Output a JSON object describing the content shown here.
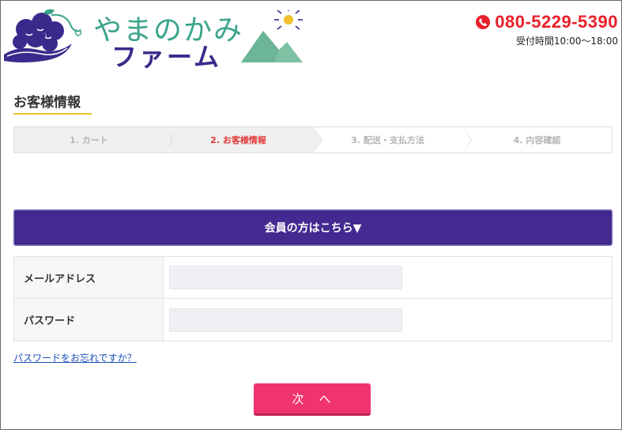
{
  "header": {
    "logo_line1": "やまのかみ",
    "logo_line2": "ファーム",
    "phone_number": "080-5229-5390",
    "business_hours": "受付時間10:00〜18:00"
  },
  "page_title": "お客様情報",
  "steps": [
    {
      "label": "1. カート",
      "state": "done"
    },
    {
      "label": "2. お客様情報",
      "state": "active"
    },
    {
      "label": "3. 配送・支払方法",
      "state": "upcoming"
    },
    {
      "label": "4. 内容確認",
      "state": "upcoming"
    }
  ],
  "member_button_label": "会員の方はこちら▼",
  "login_form": {
    "email_label": "メールアドレス",
    "email_value": "",
    "password_label": "パスワード",
    "password_value": ""
  },
  "forgot_password_link": "パスワードをお忘れですか？",
  "next_button_label": "次　へ",
  "colors": {
    "accent_purple": "#432a90",
    "phone_red": "#e8202a",
    "next_pink": "#f0346e",
    "active_step_red": "#e23b3b",
    "title_underline_yellow": "#f2c12e"
  }
}
